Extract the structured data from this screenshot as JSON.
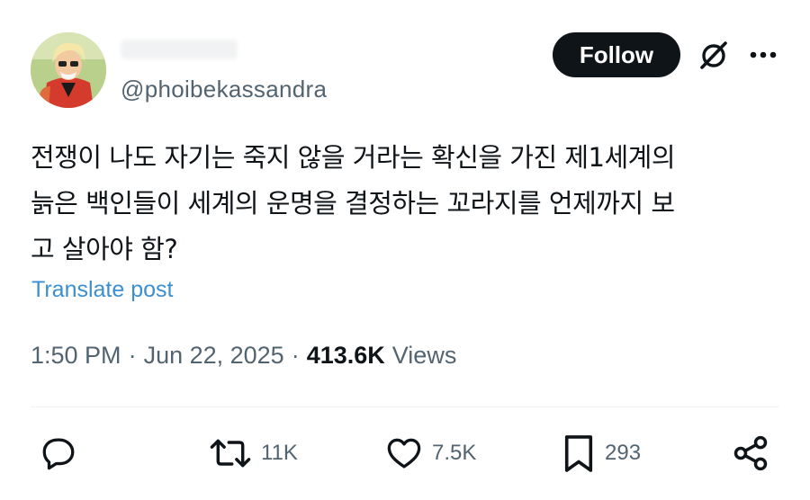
{
  "header": {
    "handle": "@phoibekassandra",
    "follow_label": "Follow"
  },
  "icons": {
    "grok": "grok-icon",
    "more": "more-icon"
  },
  "post": {
    "text": "전쟁이 나도 자기는 죽지 않을 거라는 확신을 가진 제1세계의\n늙은 백인들이 세계의 운명을 결정하는 꼬라지를 언제까지 보\n고 살아야 함?",
    "translate_label": "Translate post",
    "time": "1:50 PM",
    "date": "Jun 22, 2025",
    "views_count": "413.6K",
    "views_label": "Views"
  },
  "actions": {
    "reply": {
      "icon": "reply-icon"
    },
    "repost": {
      "icon": "repost-icon",
      "count": "11K"
    },
    "like": {
      "icon": "heart-icon",
      "count": "7.5K"
    },
    "bookmark": {
      "icon": "bookmark-icon",
      "count": "293"
    },
    "share": {
      "icon": "share-icon"
    }
  },
  "colors": {
    "text": "#0f1419",
    "secondary": "#536471",
    "link": "#3b8fd1",
    "button": "#0f1419"
  }
}
